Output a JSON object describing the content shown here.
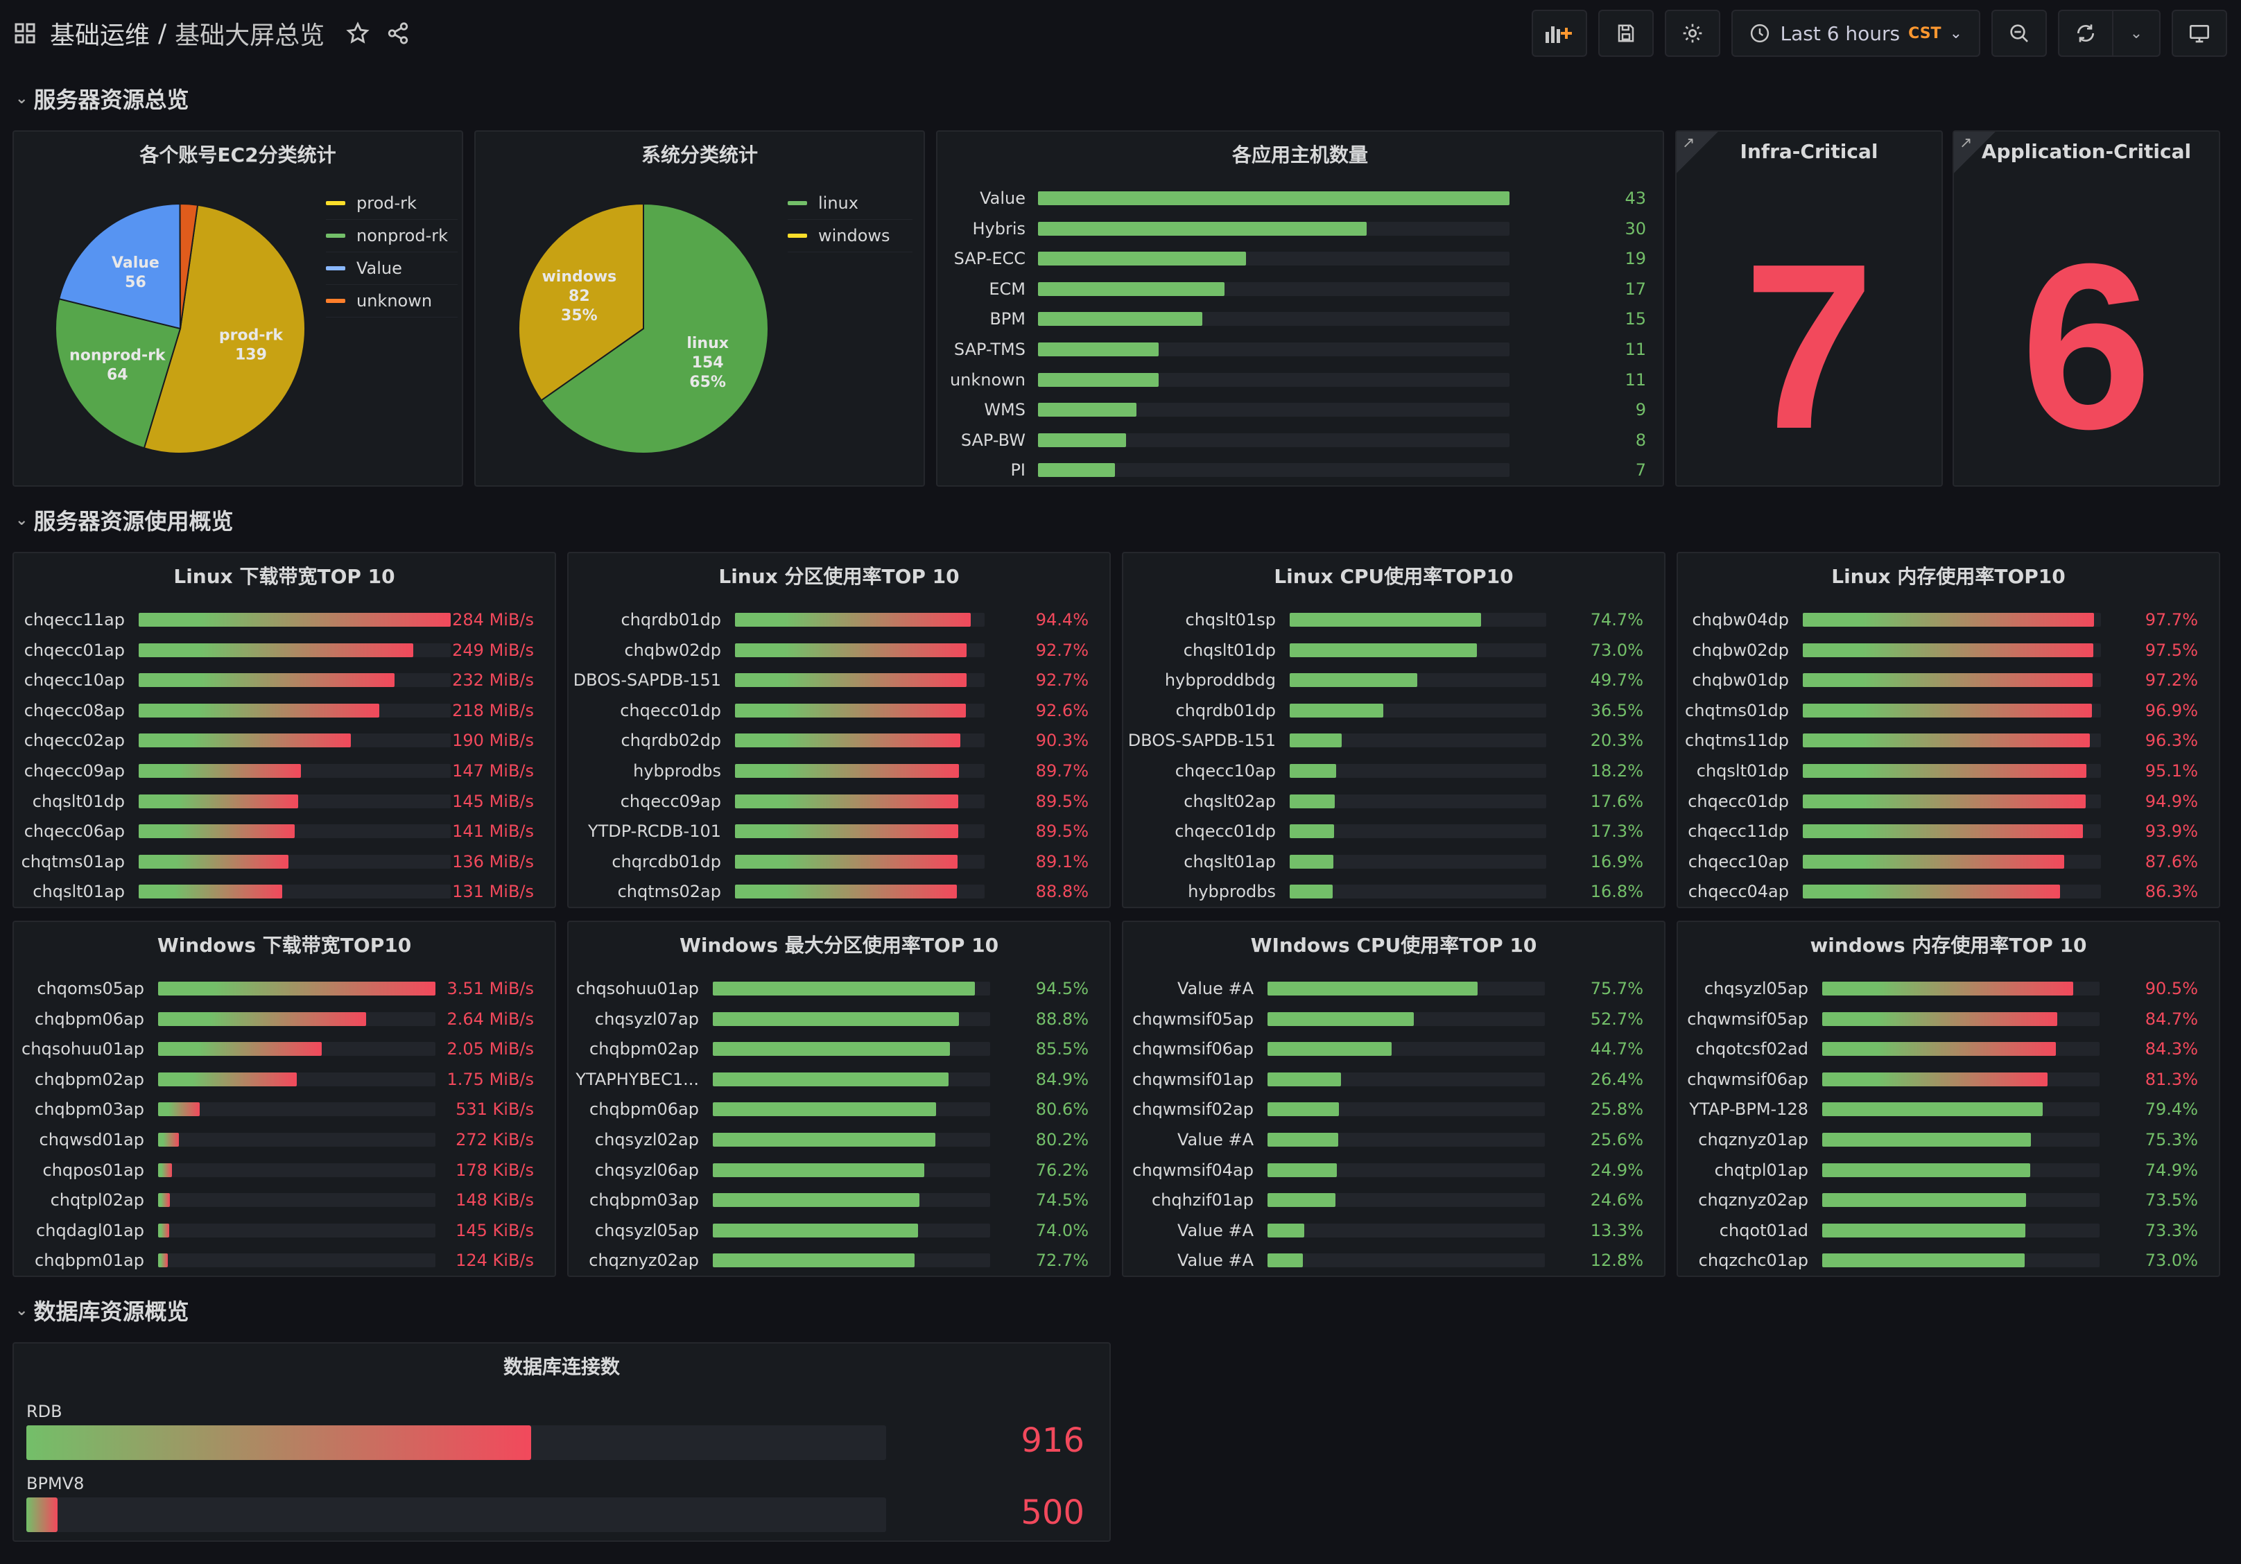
{
  "header": {
    "crumb1": "基础运维",
    "sep": "/",
    "crumb2": "基础大屏总览",
    "time_range": "Last 6 hours",
    "timezone": "CST"
  },
  "rows": {
    "r1": "服务器资源总览",
    "r2": "服务器资源使用概览",
    "r3": "数据库资源概览"
  },
  "colors": {
    "green": "#73bf69",
    "yellow": "#c8a213",
    "blue": "#5794f2",
    "orange": "#ef5f1c",
    "red": "#f2495c",
    "panel": "#181b1f"
  },
  "ec2pie": {
    "title": "各个账号EC2分类统计",
    "slices": [
      {
        "name": "prod-rk",
        "value": 139,
        "color": "#c8a213",
        "label": "prod-rk",
        "label2": "139"
      },
      {
        "name": "nonprod-rk",
        "value": 64,
        "color": "#56a64b",
        "label": "nonprod-rk",
        "label2": "64"
      },
      {
        "name": "Value",
        "value": 56,
        "color": "#5794f2",
        "label": "Value",
        "label2": "56"
      },
      {
        "name": "unknown",
        "value": 6,
        "color": "#e05c1c",
        "label": "",
        "label2": ""
      }
    ],
    "legend": [
      "prod-rk",
      "nonprod-rk",
      "Value",
      "unknown"
    ],
    "legend_colors": [
      "#fade2a",
      "#73bf69",
      "#8ab8ff",
      "#ff7f2b"
    ]
  },
  "ospie": {
    "title": "系统分类统计",
    "slices": [
      {
        "name": "linux",
        "value": 154,
        "color": "#56a64b",
        "label": "linux",
        "label2": "154",
        "label3": "65%"
      },
      {
        "name": "windows",
        "value": 82,
        "color": "#c8a213",
        "label": "windows",
        "label2": "82",
        "label3": "35%"
      }
    ],
    "legend": [
      "linux",
      "windows"
    ],
    "legend_colors": [
      "#73bf69",
      "#fade2a"
    ]
  },
  "apphosts": {
    "title": "各应用主机数量",
    "max": 43,
    "items": [
      {
        "label": "Value",
        "value": 43
      },
      {
        "label": "Hybris",
        "value": 30
      },
      {
        "label": "SAP-ECC",
        "value": 19
      },
      {
        "label": "ECM",
        "value": 17
      },
      {
        "label": "BPM",
        "value": 15
      },
      {
        "label": "SAP-TMS",
        "value": 11
      },
      {
        "label": "unknown",
        "value": 11
      },
      {
        "label": "WMS",
        "value": 9
      },
      {
        "label": "SAP-BW",
        "value": 8
      },
      {
        "label": "PI",
        "value": 7
      }
    ]
  },
  "infra": {
    "title": "Infra-Critical",
    "value": "7"
  },
  "appcrit": {
    "title": "Application-Critical",
    "value": "6"
  },
  "lin_bw": {
    "title": "Linux 下载带宽TOP 10",
    "items": [
      {
        "label": "chqecc11ap",
        "pct": 100,
        "text": "284 MiB/s"
      },
      {
        "label": "chqecc01ap",
        "pct": 88,
        "text": "249 MiB/s"
      },
      {
        "label": "chqecc10ap",
        "pct": 82,
        "text": "232 MiB/s"
      },
      {
        "label": "chqecc08ap",
        "pct": 77,
        "text": "218 MiB/s"
      },
      {
        "label": "chqecc02ap",
        "pct": 68,
        "text": "190 MiB/s"
      },
      {
        "label": "chqecc09ap",
        "pct": 52,
        "text": "147 MiB/s"
      },
      {
        "label": "chqslt01dp",
        "pct": 51,
        "text": "145 MiB/s"
      },
      {
        "label": "chqecc06ap",
        "pct": 50,
        "text": "141 MiB/s"
      },
      {
        "label": "chqtms01ap",
        "pct": 48,
        "text": "136 MiB/s"
      },
      {
        "label": "chqslt01ap",
        "pct": 46,
        "text": "131 MiB/s"
      }
    ]
  },
  "lin_disk": {
    "title": "Linux 分区使用率TOP 10",
    "items": [
      {
        "label": "chqrdb01dp",
        "pct": 94.4,
        "text": "94.4%"
      },
      {
        "label": "chqbw02dp",
        "pct": 92.7,
        "text": "92.7%"
      },
      {
        "label": "DBOS-SAPDB-151",
        "pct": 92.7,
        "text": "92.7%"
      },
      {
        "label": "chqecc01dp",
        "pct": 92.6,
        "text": "92.6%"
      },
      {
        "label": "chqrdb02dp",
        "pct": 90.3,
        "text": "90.3%"
      },
      {
        "label": "hybprodbs",
        "pct": 89.7,
        "text": "89.7%"
      },
      {
        "label": "chqecc09ap",
        "pct": 89.5,
        "text": "89.5%"
      },
      {
        "label": "YTDP-RCDB-101",
        "pct": 89.5,
        "text": "89.5%"
      },
      {
        "label": "chqrcdb01dp",
        "pct": 89.1,
        "text": "89.1%"
      },
      {
        "label": "chqtms02ap",
        "pct": 88.8,
        "text": "88.8%"
      }
    ]
  },
  "lin_cpu": {
    "title": "Linux CPU使用率TOP10",
    "items": [
      {
        "label": "chqslt01sp",
        "pct": 74.7,
        "text": "74.7%"
      },
      {
        "label": "chqslt01dp",
        "pct": 73.0,
        "text": "73.0%"
      },
      {
        "label": "hybproddbdg",
        "pct": 49.7,
        "text": "49.7%"
      },
      {
        "label": "chqrdb01dp",
        "pct": 36.5,
        "text": "36.5%"
      },
      {
        "label": "DBOS-SAPDB-151",
        "pct": 20.3,
        "text": "20.3%"
      },
      {
        "label": "chqecc10ap",
        "pct": 18.2,
        "text": "18.2%"
      },
      {
        "label": "chqslt02ap",
        "pct": 17.6,
        "text": "17.6%"
      },
      {
        "label": "chqecc01dp",
        "pct": 17.3,
        "text": "17.3%"
      },
      {
        "label": "chqslt01ap",
        "pct": 16.9,
        "text": "16.9%"
      },
      {
        "label": "hybprodbs",
        "pct": 16.8,
        "text": "16.8%"
      }
    ]
  },
  "lin_mem": {
    "title": "Linux 内存使用率TOP10",
    "items": [
      {
        "label": "chqbw04dp",
        "pct": 97.7,
        "text": "97.7%"
      },
      {
        "label": "chqbw02dp",
        "pct": 97.5,
        "text": "97.5%"
      },
      {
        "label": "chqbw01dp",
        "pct": 97.2,
        "text": "97.2%"
      },
      {
        "label": "chqtms01dp",
        "pct": 96.9,
        "text": "96.9%"
      },
      {
        "label": "chqtms11dp",
        "pct": 96.3,
        "text": "96.3%"
      },
      {
        "label": "chqslt01dp",
        "pct": 95.1,
        "text": "95.1%"
      },
      {
        "label": "chqecc01dp",
        "pct": 94.9,
        "text": "94.9%"
      },
      {
        "label": "chqecc11dp",
        "pct": 93.9,
        "text": "93.9%"
      },
      {
        "label": "chqecc10ap",
        "pct": 87.6,
        "text": "87.6%"
      },
      {
        "label": "chqecc04ap",
        "pct": 86.3,
        "text": "86.3%"
      }
    ]
  },
  "win_bw": {
    "title": "Windows 下载带宽TOP10",
    "items": [
      {
        "label": "chqoms05ap",
        "pct": 100,
        "text": "3.51 MiB/s"
      },
      {
        "label": "chqbpm06ap",
        "pct": 75,
        "text": "2.64 MiB/s"
      },
      {
        "label": "chqsohuu01ap",
        "pct": 59,
        "text": "2.05 MiB/s"
      },
      {
        "label": "chqbpm02ap",
        "pct": 50,
        "text": "1.75 MiB/s"
      },
      {
        "label": "chqbpm03ap",
        "pct": 15,
        "text": "531 KiB/s"
      },
      {
        "label": "chqwsd01ap",
        "pct": 7.6,
        "text": "272 KiB/s"
      },
      {
        "label": "chqpos01ap",
        "pct": 5,
        "text": "178 KiB/s"
      },
      {
        "label": "chqtpl02ap",
        "pct": 4.2,
        "text": "148 KiB/s"
      },
      {
        "label": "chqdagl01ap",
        "pct": 4.1,
        "text": "145 KiB/s"
      },
      {
        "label": "chqbpm01ap",
        "pct": 3.5,
        "text": "124 KiB/s"
      }
    ]
  },
  "win_disk": {
    "title": "Windows 最大分区使用率TOP 10",
    "items": [
      {
        "label": "chqsohuu01ap",
        "pct": 94.5,
        "text": "94.5%"
      },
      {
        "label": "chqsyzl07ap",
        "pct": 88.8,
        "text": "88.8%"
      },
      {
        "label": "chqbpm02ap",
        "pct": 85.5,
        "text": "85.5%"
      },
      {
        "label": "YTAPHYBEC1...",
        "pct": 84.9,
        "text": "84.9%"
      },
      {
        "label": "chqbpm06ap",
        "pct": 80.6,
        "text": "80.6%"
      },
      {
        "label": "chqsyzl02ap",
        "pct": 80.2,
        "text": "80.2%"
      },
      {
        "label": "chqsyzl06ap",
        "pct": 76.2,
        "text": "76.2%"
      },
      {
        "label": "chqbpm03ap",
        "pct": 74.5,
        "text": "74.5%"
      },
      {
        "label": "chqsyzl05ap",
        "pct": 74.0,
        "text": "74.0%"
      },
      {
        "label": "chqznyz02ap",
        "pct": 72.7,
        "text": "72.7%"
      }
    ]
  },
  "win_cpu": {
    "title": "WIndows CPU使用率TOP 10",
    "items": [
      {
        "label": "Value #A",
        "pct": 75.7,
        "text": "75.7%"
      },
      {
        "label": "chqwmsif05ap",
        "pct": 52.7,
        "text": "52.7%"
      },
      {
        "label": "chqwmsif06ap",
        "pct": 44.7,
        "text": "44.7%"
      },
      {
        "label": "chqwmsif01ap",
        "pct": 26.4,
        "text": "26.4%"
      },
      {
        "label": "chqwmsif02ap",
        "pct": 25.8,
        "text": "25.8%"
      },
      {
        "label": "Value #A",
        "pct": 25.6,
        "text": "25.6%"
      },
      {
        "label": "chqwmsif04ap",
        "pct": 24.9,
        "text": "24.9%"
      },
      {
        "label": "chqhzif01ap",
        "pct": 24.6,
        "text": "24.6%"
      },
      {
        "label": "Value #A",
        "pct": 13.3,
        "text": "13.3%"
      },
      {
        "label": "Value #A",
        "pct": 12.8,
        "text": "12.8%"
      }
    ]
  },
  "win_mem": {
    "title": "windows 内存使用率TOP 10",
    "items": [
      {
        "label": "chqsyzl05ap",
        "pct": 90.5,
        "text": "90.5%"
      },
      {
        "label": "chqwmsif05ap",
        "pct": 84.7,
        "text": "84.7%"
      },
      {
        "label": "chqotcsf02ad",
        "pct": 84.3,
        "text": "84.3%"
      },
      {
        "label": "chqwmsif06ap",
        "pct": 81.3,
        "text": "81.3%"
      },
      {
        "label": "YTAP-BPM-128",
        "pct": 79.4,
        "text": "79.4%"
      },
      {
        "label": "chqznyz01ap",
        "pct": 75.3,
        "text": "75.3%"
      },
      {
        "label": "chqtpl01ap",
        "pct": 74.9,
        "text": "74.9%"
      },
      {
        "label": "chqznyz02ap",
        "pct": 73.5,
        "text": "73.5%"
      },
      {
        "label": "chqot01ad",
        "pct": 73.3,
        "text": "73.3%"
      },
      {
        "label": "chqzchc01ap",
        "pct": 73.0,
        "text": "73.0%"
      }
    ]
  },
  "dbconn": {
    "title": "数据库连接数",
    "items": [
      {
        "label": "RDB",
        "value": "916",
        "pct": 58.7
      },
      {
        "label": "BPMV8",
        "value": "500",
        "pct": 3.6
      }
    ]
  }
}
